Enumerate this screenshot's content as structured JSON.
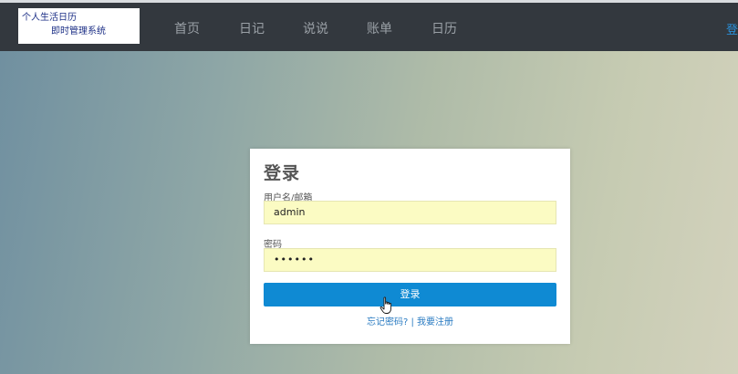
{
  "navbar": {
    "logo": {
      "line1": "个人生活日历",
      "line2": "即时管理系统"
    },
    "items": [
      {
        "label": "首页"
      },
      {
        "label": "日记"
      },
      {
        "label": "说说"
      },
      {
        "label": "账单"
      },
      {
        "label": "日历"
      }
    ],
    "right_label": "登"
  },
  "login": {
    "title": "登录",
    "username_label": "用户名/邮箱",
    "username_value": "admin",
    "password_label": "密码",
    "password_value": "••••••",
    "submit_label": "登录",
    "forgot_link": "忘记密码?",
    "separator": "|",
    "register_link": "我要注册"
  },
  "colors": {
    "navbar_bg": "#33383e",
    "nav_text": "#9aa0a6",
    "button_bg": "#0f8ad3",
    "input_bg": "#fbfbc3",
    "link": "#2a7bc2"
  },
  "icons": {
    "cursor": "hand-pointer-icon"
  }
}
